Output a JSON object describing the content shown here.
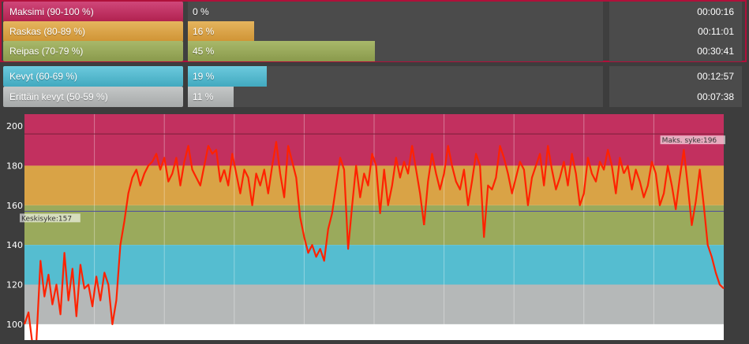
{
  "colors": {
    "maksimi": "#c2305f",
    "raskas": "#d9a346",
    "reipas": "#9aaa5c",
    "kevyt": "#55bdd0",
    "erittain_kevyt": "#b5b8b8",
    "hr_line": "#ff2200",
    "avg_line": "#4a4aa0",
    "max_line": "#7a1f3a"
  },
  "zones": [
    {
      "label": "Maksimi (90-100 %)",
      "pct": "0 %",
      "fraction": 0.0,
      "time": "00:00:16"
    },
    {
      "label": "Raskas (80-89 %)",
      "pct": "16 %",
      "fraction": 0.16,
      "time": "00:11:01"
    },
    {
      "label": "Reipas (70-79 %)",
      "pct": "45 %",
      "fraction": 0.45,
      "time": "00:30:41"
    },
    {
      "label": "Kevyt (60-69 %)",
      "pct": "19 %",
      "fraction": 0.19,
      "time": "00:12:57"
    },
    {
      "label": "Erittäin kevyt (50-59 %)",
      "pct": "11 %",
      "fraction": 0.11,
      "time": "00:07:38"
    }
  ],
  "chart_data": {
    "type": "line",
    "title": "",
    "xlabel": "",
    "ylabel": "",
    "ylim": [
      92,
      206
    ],
    "yticks": [
      100,
      120,
      140,
      160,
      180,
      200
    ],
    "bands": [
      {
        "from": 180,
        "to": 206,
        "zone": "maksimi"
      },
      {
        "from": 160,
        "to": 180,
        "zone": "raskas"
      },
      {
        "from": 140,
        "to": 160,
        "zone": "reipas"
      },
      {
        "from": 120,
        "to": 140,
        "zone": "kevyt"
      },
      {
        "from": 100,
        "to": 120,
        "zone": "erittain_kevyt"
      }
    ],
    "reference_lines": [
      {
        "name": "Maks. syke",
        "value": 196,
        "label": "Maks. syke:196",
        "position": "right"
      },
      {
        "name": "Keskisyke",
        "value": 157,
        "label": "Keskisyke:157",
        "position": "left"
      }
    ],
    "grid": true,
    "series": [
      {
        "name": "",
        "x": [
          0,
          2,
          4,
          6,
          8,
          10,
          12,
          14,
          16,
          18,
          20,
          22,
          24,
          26,
          28,
          30,
          32,
          34,
          36,
          38,
          40,
          42,
          44,
          46,
          48,
          50,
          52,
          54,
          56,
          58,
          60,
          62,
          64,
          66,
          68,
          70,
          72,
          74,
          76,
          78,
          80,
          82,
          84,
          86,
          88,
          90,
          92,
          94,
          96,
          98,
          100
        ],
        "values": [
          100,
          106,
          90,
          92,
          132,
          114,
          125,
          110,
          120,
          105,
          136,
          112,
          128,
          104,
          130,
          118,
          120,
          109,
          124,
          112,
          126,
          120,
          100,
          112,
          140,
          152,
          166,
          174,
          178,
          170,
          176,
          180,
          182,
          186,
          178,
          184,
          172,
          176,
          184,
          170,
          182,
          190,
          178,
          174,
          170,
          180,
          190,
          186,
          188,
          172,
          178
        ]
      },
      {
        "name": "",
        "x": [
          100,
          102,
          104,
          106,
          108,
          110,
          112,
          114,
          116,
          118,
          120,
          122,
          124,
          126,
          128,
          130,
          132,
          134,
          136,
          138,
          140,
          142,
          144,
          146,
          148,
          150,
          152,
          154,
          156,
          158,
          160,
          162,
          164,
          166,
          168,
          170,
          172,
          174,
          176,
          178,
          180,
          182,
          184,
          186,
          188,
          190,
          192,
          194,
          196,
          198,
          200
        ],
        "values": [
          178,
          170,
          186,
          176,
          166,
          178,
          174,
          160,
          176,
          170,
          178,
          166,
          180,
          192,
          176,
          164,
          190,
          182,
          174,
          154,
          144,
          136,
          140,
          134,
          138,
          132,
          148,
          156,
          170,
          184,
          178,
          138,
          160,
          180,
          164,
          176,
          170,
          186,
          180,
          156,
          178,
          160,
          170,
          184,
          174,
          182,
          176,
          190,
          178,
          166,
          150
        ]
      },
      {
        "name": "",
        "x": [
          200,
          202,
          204,
          206,
          208,
          210,
          212,
          214,
          216,
          218,
          220,
          222,
          224,
          226,
          228,
          230,
          232,
          234,
          236,
          238,
          240,
          242,
          244,
          246,
          248,
          250,
          252,
          254,
          256,
          258,
          260,
          262,
          264,
          266,
          268,
          270,
          272,
          274,
          276,
          278,
          280,
          282,
          284,
          286,
          288,
          290,
          292,
          294,
          296,
          298,
          300
        ],
        "values": [
          150,
          172,
          186,
          176,
          168,
          176,
          190,
          180,
          172,
          168,
          178,
          160,
          172,
          186,
          180,
          144,
          170,
          168,
          174,
          190,
          184,
          176,
          166,
          174,
          182,
          178,
          160,
          174,
          180,
          186,
          170,
          190,
          178,
          168,
          174,
          182,
          170,
          186,
          176,
          160,
          166,
          184,
          176,
          172,
          182,
          178,
          188,
          180,
          166,
          184,
          176
        ]
      },
      {
        "name": "",
        "x": [
          300,
          302,
          304,
          306,
          308,
          310,
          312,
          314,
          316,
          318,
          320,
          322,
          324,
          326,
          328,
          330,
          332,
          334,
          336,
          338,
          340,
          342,
          344,
          346,
          348,
          350
        ],
        "values": [
          176,
          180,
          168,
          178,
          172,
          164,
          170,
          182,
          176,
          160,
          166,
          180,
          170,
          158,
          174,
          188,
          170,
          150,
          162,
          178,
          160,
          140,
          134,
          126,
          120,
          118
        ]
      }
    ]
  }
}
